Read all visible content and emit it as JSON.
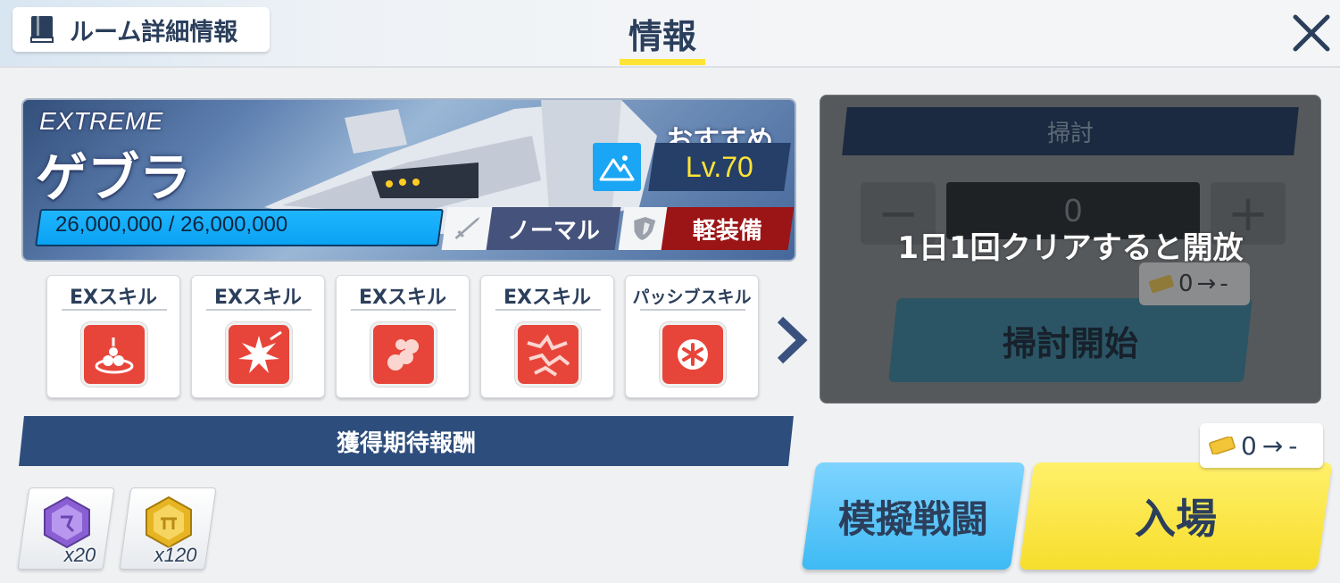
{
  "header": {
    "room_detail_label": "ルーム詳細情報",
    "page_title": "情報"
  },
  "boss": {
    "difficulty": "EXTREME",
    "name": "ゲブラ",
    "hp": "26,000,000 / 26,000,000",
    "recommend_label": "おすすめ",
    "level": "Lv.70",
    "attack_type": "ノーマル",
    "armor_type": "軽装備",
    "colors": {
      "hp_bar": "#0aa2f2",
      "level_text": "#ffe436",
      "attack_type": "#45527c",
      "armor_type": "#9b1416"
    }
  },
  "skills": [
    {
      "label": "EXスキル",
      "icon": "ex-skill-bomb-icon"
    },
    {
      "label": "EXスキル",
      "icon": "ex-skill-blast-icon"
    },
    {
      "label": "EXスキル",
      "icon": "ex-skill-smoke-icon"
    },
    {
      "label": "EXスキル",
      "icon": "ex-skill-crack-icon"
    },
    {
      "label": "パッシブスキル",
      "icon": "passive-skill-gear-icon"
    }
  ],
  "rewards": {
    "title": "獲得期待報酬",
    "items": [
      {
        "icon": "purple-gem-icon",
        "count": "x20"
      },
      {
        "icon": "gold-gem-icon",
        "count": "x120"
      }
    ]
  },
  "sweep": {
    "title": "掃討",
    "count": "0",
    "minus": "−",
    "plus": "+",
    "lock_message": "1日1回クリアすると開放",
    "cost": "0",
    "cost_arrow": "→",
    "cost_after": "-",
    "start_label": "掃討開始"
  },
  "actions": {
    "entry_cost": "0",
    "entry_cost_arrow": "→",
    "entry_cost_after": "-",
    "mock_battle_label": "模擬戦闘",
    "enter_label": "入場"
  }
}
